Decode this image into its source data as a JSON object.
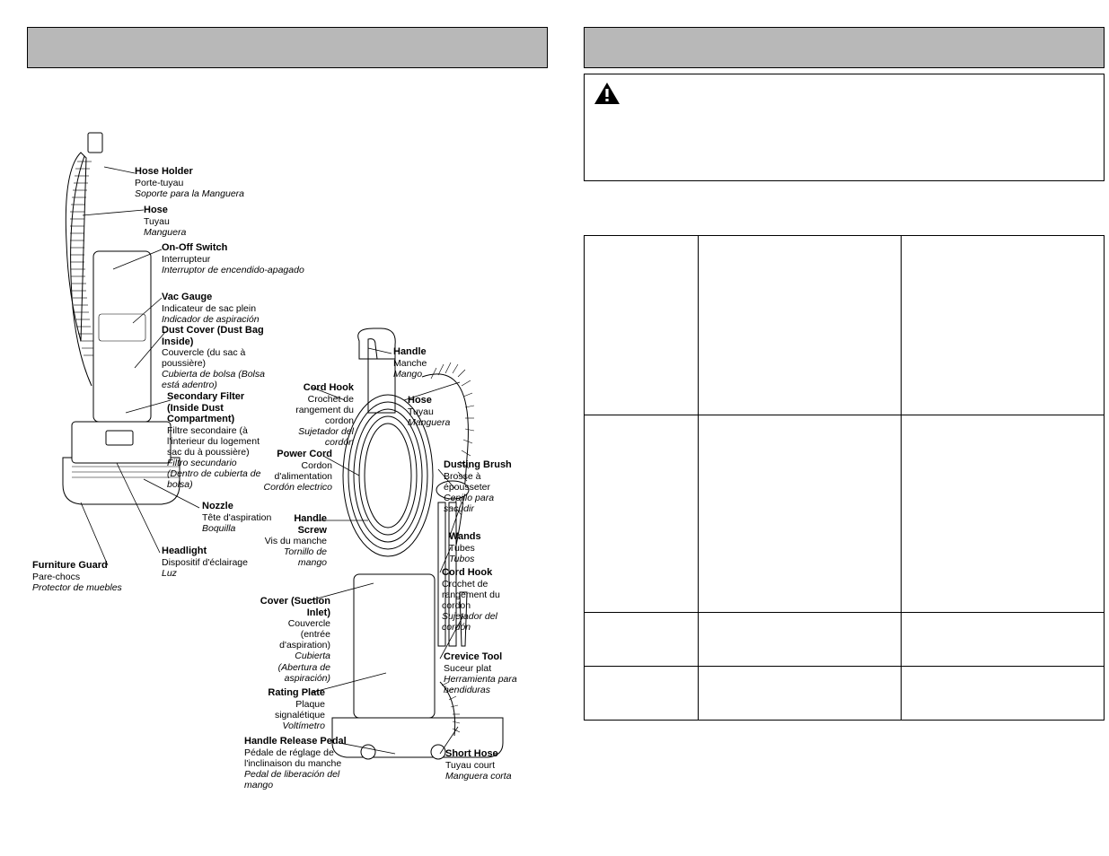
{
  "labels": {
    "hose_holder": {
      "en": "Hose Holder",
      "fr": "Porte-tuyau",
      "es": "Soporte para la Manguera"
    },
    "hose": {
      "en": "Hose",
      "fr": "Tuyau",
      "es": "Manguera"
    },
    "on_off": {
      "en": "On-Off Switch",
      "fr": "Interrupteur",
      "es": "Interruptor de encendido-apagado"
    },
    "vac_gauge": {
      "en": "Vac Gauge",
      "fr": "Indicateur de sac plein",
      "es": "Indicador de aspiración"
    },
    "dust_cover": {
      "en": "Dust Cover (Dust Bag Inside)",
      "fr": "Couvercle (du sac à poussière)",
      "es": "Cubierta de bolsa (Bolsa está adentro)"
    },
    "secondary_filter": {
      "en": "Secondary Filter (Inside Dust Compartment)",
      "fr": "Filtre secondaire (à l'interieur du logement sac du à poussière)",
      "es": "Filtro secundario (Dentro de cubierta de bolsa)"
    },
    "nozzle": {
      "en": "Nozzle",
      "fr": "Tête d'aspiration",
      "es": "Boquilla"
    },
    "headlight": {
      "en": "Headlight",
      "fr": "Dispositif d'éclairage",
      "es": "Luz"
    },
    "furniture_guard": {
      "en": "Furniture Guard",
      "fr": "Pare-chocs",
      "es": "Protector de muebles"
    },
    "handle": {
      "en": "Handle",
      "fr": "Manche",
      "es": "Mango"
    },
    "hose2": {
      "en": "Hose",
      "fr": "Tuyau",
      "es": "Manguera"
    },
    "cord_hook": {
      "en": "Cord Hook",
      "fr": "Crochet de rangement du cordon",
      "es": "Sujetador del cordón"
    },
    "power_cord": {
      "en": "Power Cord",
      "fr": "Cordon d'alimentation",
      "es": "Cordón electrico"
    },
    "handle_screw": {
      "en": "Handle Screw",
      "fr": "Vis du manche",
      "es": "Tornillo de mango"
    },
    "dusting_brush": {
      "en": "Dusting Brush",
      "fr": "Brosse à épousseter",
      "es": "Cepillo para sacudir"
    },
    "wands": {
      "en": "Wands",
      "fr": "Tubes",
      "es": "Tubos"
    },
    "cord_hook2": {
      "en": "Cord Hook",
      "fr": "Crochet de rangement du cordon",
      "es": "Sujetador del cordón"
    },
    "crevice_tool": {
      "en": "Crevice Tool",
      "fr": "Suceur plat",
      "es": "Herramienta para hendiduras"
    },
    "cover_inlet": {
      "en": "Cover (Suction Inlet)",
      "fr": "Couvercle (entrée d'aspiration)",
      "es": "Cubierta (Abertura de aspiración)"
    },
    "rating_plate": {
      "en": "Rating Plate",
      "fr": "Plaque signalétique",
      "es": "Voltímetro"
    },
    "handle_release": {
      "en": "Handle Release Pedal",
      "fr": "Pédale de réglage de l'inclinaison du manche",
      "es": "Pedal de liberación del mango"
    },
    "short_hose": {
      "en": "Short Hose",
      "fr": "Tuyau court",
      "es": "Manguera corta"
    }
  }
}
